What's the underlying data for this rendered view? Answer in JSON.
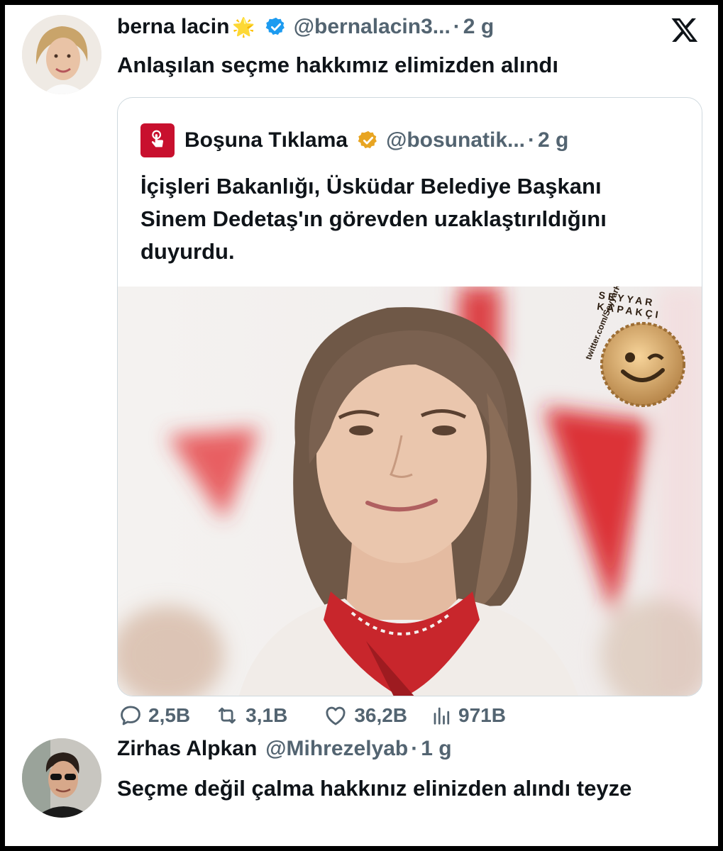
{
  "tweet": {
    "author_name": "berna lacin",
    "author_emoji": "🌟",
    "handle": "@bernalacin3...",
    "separator": "·",
    "time": "2 g",
    "text": "Anlaşılan seçme hakkımız elimizden alındı",
    "verified_color": "#1d9bf0"
  },
  "quote": {
    "author_name": "Boşuna Tıklama",
    "handle": "@bosunatik...",
    "separator": "·",
    "time": "2 g",
    "text": "İçişleri Bakanlığı, Üsküdar Belediye Başkanı Sinem Dedetaş'ın görevden uzaklaştırıldığını duyurdu.",
    "verified_color": "#e8a522",
    "avatar_color": "#c8102e",
    "watermark_top": "SEYYAR KAPAKÇI",
    "watermark_side": "twitter.com/SeyyarKapakci"
  },
  "actions": {
    "replies": "2,5B",
    "retweets": "3,1B",
    "likes": "36,2B",
    "views": "971B"
  },
  "reply": {
    "author_name": "Zirhas Alpkan",
    "handle": "@Mihrezelyab",
    "separator": "·",
    "time": "1 g",
    "text": "Seçme değil çalma hakkınız elinizden alındı teyze"
  },
  "icons": [
    "x-logo-icon",
    "verified-badge-icon",
    "gold-badge-icon",
    "reply-icon",
    "retweet-icon",
    "like-icon",
    "views-icon"
  ]
}
